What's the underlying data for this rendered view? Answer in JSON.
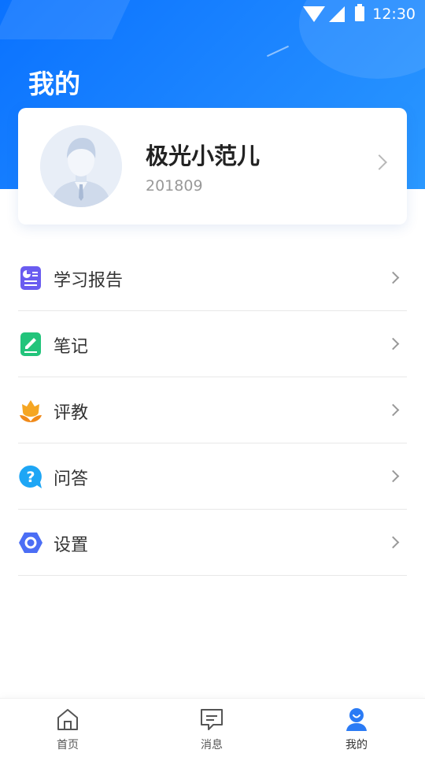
{
  "status_bar": {
    "time": "12:30"
  },
  "page": {
    "title": "我的"
  },
  "profile": {
    "name": "极光小范儿",
    "id": "201809"
  },
  "menu": [
    {
      "label": "学习报告",
      "icon": "report-icon",
      "color": "#6a5cf0"
    },
    {
      "label": "笔记",
      "icon": "note-icon",
      "color": "#22c47b"
    },
    {
      "label": "评教",
      "icon": "evaluate-flower-icon",
      "color": "#f5a623"
    },
    {
      "label": "问答",
      "icon": "question-icon",
      "color": "#1ea6f5"
    },
    {
      "label": "设置",
      "icon": "settings-hexagon-icon",
      "color": "#4b6ef5"
    }
  ],
  "tabbar": {
    "items": [
      {
        "label": "首页",
        "icon": "home-icon"
      },
      {
        "label": "消息",
        "icon": "message-icon"
      },
      {
        "label": "我的",
        "icon": "user-icon",
        "active": true
      }
    ]
  },
  "colors": {
    "brand": "#1a80ff",
    "active_tab": "#2b7bf5"
  }
}
